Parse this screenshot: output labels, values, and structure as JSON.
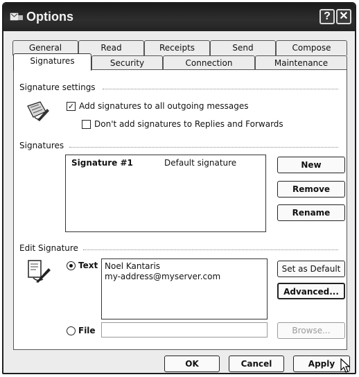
{
  "window": {
    "title": "Options"
  },
  "tabs_back": [
    {
      "label": "General"
    },
    {
      "label": "Read"
    },
    {
      "label": "Receipts"
    },
    {
      "label": "Send"
    },
    {
      "label": "Compose"
    }
  ],
  "tabs_front": [
    {
      "label": "Signatures"
    },
    {
      "label": "Security"
    },
    {
      "label": "Connection"
    },
    {
      "label": "Maintenance"
    }
  ],
  "signature_settings": {
    "heading": "Signature settings",
    "add_to_all": {
      "label": "Add signatures to all outgoing messages",
      "checked": true
    },
    "no_replies": {
      "label": "Don't add signatures to Replies and Forwards",
      "checked": false
    }
  },
  "signatures": {
    "heading": "Signatures",
    "items": [
      {
        "name": "Signature #1",
        "note": "Default signature"
      }
    ],
    "buttons": {
      "new": "New",
      "remove": "Remove",
      "rename": "Rename"
    }
  },
  "edit_signature": {
    "heading": "Edit Signature",
    "text_option": {
      "label": "Text",
      "selected": true
    },
    "text_lines": [
      "Noel Kantaris",
      "my-address@myserver.com"
    ],
    "file_option": {
      "label": "File",
      "selected": false
    },
    "buttons": {
      "set_default": "Set as Default",
      "advanced": "Advanced...",
      "browse": "Browse..."
    }
  },
  "footer": {
    "ok": "OK",
    "cancel": "Cancel",
    "apply": "Apply"
  }
}
